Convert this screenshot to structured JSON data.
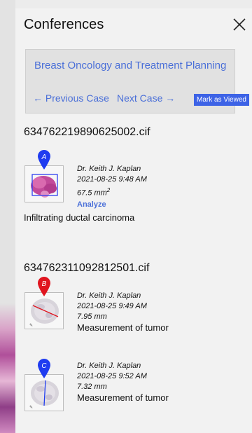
{
  "panel": {
    "title": "Conferences"
  },
  "case": {
    "title": "Breast Oncology and Treatment Planning",
    "previous_label": "← Previous Case",
    "next_label": "Next Case →",
    "mark_viewed_label": "Mark as Viewed"
  },
  "files": [
    {
      "name": "634762219890625002.cif",
      "annotations": [
        {
          "marker": "A",
          "marker_color": "#1f3cf0",
          "author": "Dr. Keith J. Kaplan",
          "datetime": "2021-08-25 9:48 AM",
          "measurement_value": "67.5 mm",
          "measurement_sup": "2",
          "action": "Analyze",
          "description": "Infiltrating ductal carcinoma"
        }
      ]
    },
    {
      "name": "634762311092812501.cif",
      "annotations": [
        {
          "marker": "B",
          "marker_color": "#e0141e",
          "author": "Dr. Keith J. Kaplan",
          "datetime": "2021-08-25 9:49 AM",
          "measurement_value": "7.95 mm",
          "description": "Measurement of tumor"
        },
        {
          "marker": "C",
          "marker_color": "#1f3cf0",
          "author": "Dr. Keith J. Kaplan",
          "datetime": "2021-08-25 9:52 AM",
          "measurement_value": "7.32 mm",
          "description": "Measurement of tumor"
        }
      ]
    }
  ]
}
